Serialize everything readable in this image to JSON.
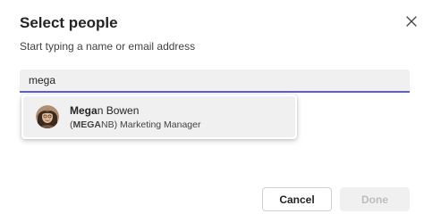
{
  "dialog": {
    "title": "Select people",
    "subtitle": "Start typing a name or email address"
  },
  "search": {
    "value": "mega",
    "placeholder": ""
  },
  "suggestions": [
    {
      "name_match": "Mega",
      "name_rest": "n Bowen",
      "alias_open": "(",
      "alias_match": "MEGA",
      "alias_rest": "NB)",
      "job_title": "Marketing Manager"
    }
  ],
  "buttons": {
    "cancel_label": "Cancel",
    "done_label": "Done"
  },
  "icons": {
    "close": "close-icon",
    "avatar": "person-photo"
  },
  "colors": {
    "accent": "#5b5fc7",
    "text_primary": "#242424",
    "text_secondary": "#424242",
    "disabled_text": "#bdbdbd",
    "input_background": "#f0f0f0"
  }
}
